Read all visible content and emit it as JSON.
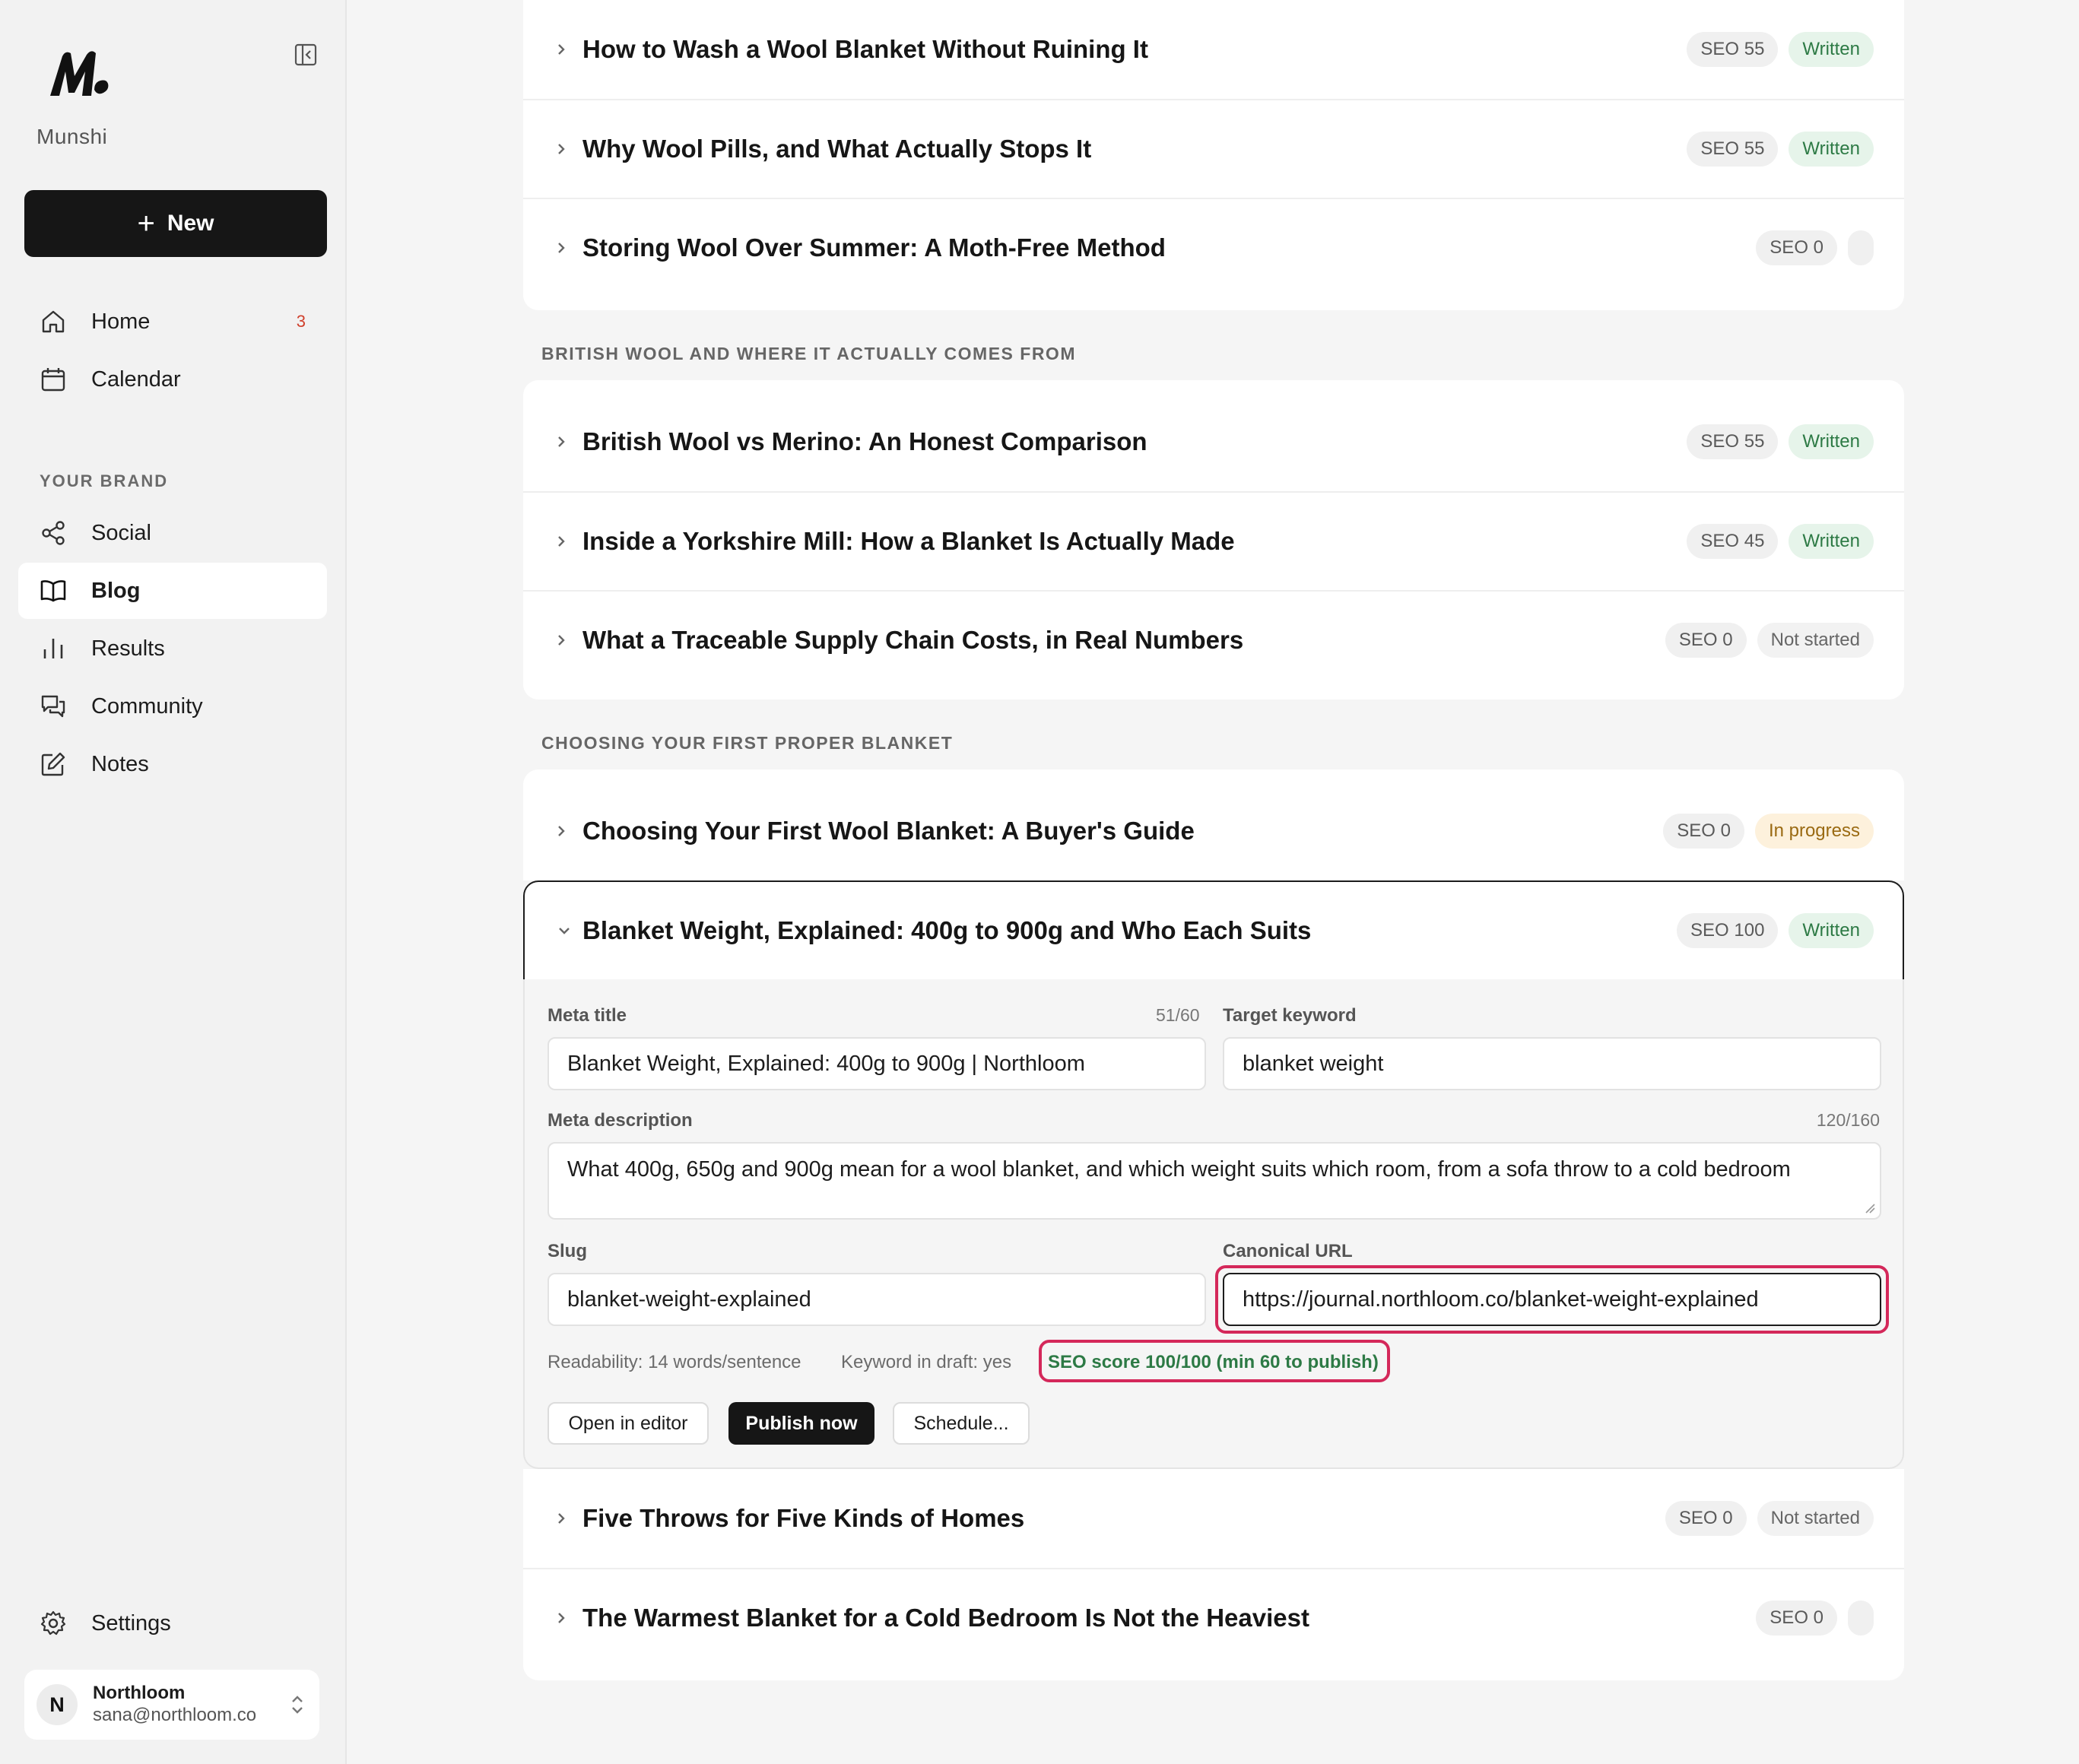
{
  "sidebar": {
    "brand": "Munshi",
    "new_button": "New",
    "nav": [
      {
        "label": "Home",
        "icon": "home-icon",
        "count": "3"
      },
      {
        "label": "Calendar",
        "icon": "calendar-icon"
      }
    ],
    "section_label": "YOUR BRAND",
    "brand_nav": [
      {
        "label": "Social",
        "icon": "share-icon"
      },
      {
        "label": "Blog",
        "icon": "book-icon",
        "active": true
      },
      {
        "label": "Results",
        "icon": "bar-chart-icon"
      },
      {
        "label": "Community",
        "icon": "chat-bubbles-icon"
      },
      {
        "label": "Notes",
        "icon": "edit-note-icon"
      }
    ],
    "settings": "Settings",
    "account": {
      "initial": "N",
      "name": "Northloom",
      "email": "sana@northloom.co"
    }
  },
  "groups": [
    {
      "label": "",
      "posts": [
        {
          "title": "How to Wash a Wool Blanket Without Ruining It",
          "seo": "SEO 55",
          "status": "Written"
        },
        {
          "title": "Why Wool Pills, and What Actually Stops It",
          "seo": "SEO 55",
          "status": "Written"
        },
        {
          "title": "Storing Wool Over Summer: A Moth-Free Method",
          "seo": "SEO 0",
          "status": ""
        }
      ]
    },
    {
      "label": "BRITISH WOOL AND WHERE IT ACTUALLY COMES FROM",
      "posts": [
        {
          "title": "British Wool vs Merino: An Honest Comparison",
          "seo": "SEO 55",
          "status": "Written"
        },
        {
          "title": "Inside a Yorkshire Mill: How a Blanket Is Actually Made",
          "seo": "SEO 45",
          "status": "Written"
        },
        {
          "title": "What a Traceable Supply Chain Costs, in Real Numbers",
          "seo": "SEO 0",
          "status": "Not started"
        }
      ]
    },
    {
      "label": "CHOOSING YOUR FIRST PROPER BLANKET",
      "posts": [
        {
          "title": "Choosing Your First Wool Blanket: A Buyer's Guide",
          "seo": "SEO 0",
          "status": "In progress"
        },
        {
          "title": "Blanket Weight, Explained: 400g to 900g and Who Each Suits",
          "seo": "SEO 100",
          "status": "Written"
        },
        {
          "title": "Five Throws for Five Kinds of Homes",
          "seo": "SEO 0",
          "status": "Not started"
        },
        {
          "title": "The Warmest Blanket for a Cold Bedroom Is Not the Heaviest",
          "seo": "SEO 0",
          "status": ""
        }
      ]
    }
  ],
  "detail": {
    "meta_title_label": "Meta title",
    "meta_title_count": "51/60",
    "meta_title_value": "Blanket Weight, Explained: 400g to 900g | Northloom",
    "target_keyword_label": "Target keyword",
    "target_keyword_value": "blanket weight",
    "meta_description_label": "Meta description",
    "meta_description_count": "120/160",
    "meta_description_value": "What 400g, 650g and 900g mean for a wool blanket, and which weight suits which room, from a sofa throw to a cold bedroom",
    "slug_label": "Slug",
    "slug_value": "blanket-weight-explained",
    "canonical_label": "Canonical URL",
    "canonical_value": "https://journal.northloom.co/blanket-weight-explained",
    "readability": "Readability: 14 words/sentence",
    "keyword_in_draft": "Keyword in draft: yes",
    "seo_score": "SEO score 100/100 (min 60 to publish)",
    "buttons": {
      "open_editor": "Open in editor",
      "publish": "Publish now",
      "schedule": "Schedule..."
    }
  },
  "colors": {
    "written_bg": "#e6f4ea",
    "written_text": "#2d7a45",
    "in_progress_bg": "#fdf1dc",
    "in_progress_text": "#9a6a12",
    "highlight": "#d4285a",
    "primary": "#161616"
  }
}
